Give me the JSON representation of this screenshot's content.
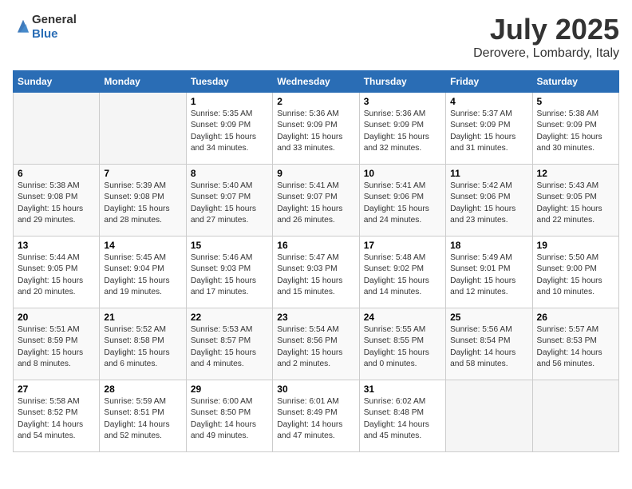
{
  "header": {
    "logo": {
      "general": "General",
      "blue": "Blue"
    },
    "month": "July 2025",
    "location": "Derovere, Lombardy, Italy"
  },
  "days_of_week": [
    "Sunday",
    "Monday",
    "Tuesday",
    "Wednesday",
    "Thursday",
    "Friday",
    "Saturday"
  ],
  "weeks": [
    [
      {
        "day": "",
        "empty": true
      },
      {
        "day": "",
        "empty": true
      },
      {
        "day": "1",
        "sunrise": "5:35 AM",
        "sunset": "9:09 PM",
        "daylight": "15 hours and 34 minutes."
      },
      {
        "day": "2",
        "sunrise": "5:36 AM",
        "sunset": "9:09 PM",
        "daylight": "15 hours and 33 minutes."
      },
      {
        "day": "3",
        "sunrise": "5:36 AM",
        "sunset": "9:09 PM",
        "daylight": "15 hours and 32 minutes."
      },
      {
        "day": "4",
        "sunrise": "5:37 AM",
        "sunset": "9:09 PM",
        "daylight": "15 hours and 31 minutes."
      },
      {
        "day": "5",
        "sunrise": "5:38 AM",
        "sunset": "9:09 PM",
        "daylight": "15 hours and 30 minutes."
      }
    ],
    [
      {
        "day": "6",
        "sunrise": "5:38 AM",
        "sunset": "9:08 PM",
        "daylight": "15 hours and 29 minutes."
      },
      {
        "day": "7",
        "sunrise": "5:39 AM",
        "sunset": "9:08 PM",
        "daylight": "15 hours and 28 minutes."
      },
      {
        "day": "8",
        "sunrise": "5:40 AM",
        "sunset": "9:07 PM",
        "daylight": "15 hours and 27 minutes."
      },
      {
        "day": "9",
        "sunrise": "5:41 AM",
        "sunset": "9:07 PM",
        "daylight": "15 hours and 26 minutes."
      },
      {
        "day": "10",
        "sunrise": "5:41 AM",
        "sunset": "9:06 PM",
        "daylight": "15 hours and 24 minutes."
      },
      {
        "day": "11",
        "sunrise": "5:42 AM",
        "sunset": "9:06 PM",
        "daylight": "15 hours and 23 minutes."
      },
      {
        "day": "12",
        "sunrise": "5:43 AM",
        "sunset": "9:05 PM",
        "daylight": "15 hours and 22 minutes."
      }
    ],
    [
      {
        "day": "13",
        "sunrise": "5:44 AM",
        "sunset": "9:05 PM",
        "daylight": "15 hours and 20 minutes."
      },
      {
        "day": "14",
        "sunrise": "5:45 AM",
        "sunset": "9:04 PM",
        "daylight": "15 hours and 19 minutes."
      },
      {
        "day": "15",
        "sunrise": "5:46 AM",
        "sunset": "9:03 PM",
        "daylight": "15 hours and 17 minutes."
      },
      {
        "day": "16",
        "sunrise": "5:47 AM",
        "sunset": "9:03 PM",
        "daylight": "15 hours and 15 minutes."
      },
      {
        "day": "17",
        "sunrise": "5:48 AM",
        "sunset": "9:02 PM",
        "daylight": "15 hours and 14 minutes."
      },
      {
        "day": "18",
        "sunrise": "5:49 AM",
        "sunset": "9:01 PM",
        "daylight": "15 hours and 12 minutes."
      },
      {
        "day": "19",
        "sunrise": "5:50 AM",
        "sunset": "9:00 PM",
        "daylight": "15 hours and 10 minutes."
      }
    ],
    [
      {
        "day": "20",
        "sunrise": "5:51 AM",
        "sunset": "8:59 PM",
        "daylight": "15 hours and 8 minutes."
      },
      {
        "day": "21",
        "sunrise": "5:52 AM",
        "sunset": "8:58 PM",
        "daylight": "15 hours and 6 minutes."
      },
      {
        "day": "22",
        "sunrise": "5:53 AM",
        "sunset": "8:57 PM",
        "daylight": "15 hours and 4 minutes."
      },
      {
        "day": "23",
        "sunrise": "5:54 AM",
        "sunset": "8:56 PM",
        "daylight": "15 hours and 2 minutes."
      },
      {
        "day": "24",
        "sunrise": "5:55 AM",
        "sunset": "8:55 PM",
        "daylight": "15 hours and 0 minutes."
      },
      {
        "day": "25",
        "sunrise": "5:56 AM",
        "sunset": "8:54 PM",
        "daylight": "14 hours and 58 minutes."
      },
      {
        "day": "26",
        "sunrise": "5:57 AM",
        "sunset": "8:53 PM",
        "daylight": "14 hours and 56 minutes."
      }
    ],
    [
      {
        "day": "27",
        "sunrise": "5:58 AM",
        "sunset": "8:52 PM",
        "daylight": "14 hours and 54 minutes."
      },
      {
        "day": "28",
        "sunrise": "5:59 AM",
        "sunset": "8:51 PM",
        "daylight": "14 hours and 52 minutes."
      },
      {
        "day": "29",
        "sunrise": "6:00 AM",
        "sunset": "8:50 PM",
        "daylight": "14 hours and 49 minutes."
      },
      {
        "day": "30",
        "sunrise": "6:01 AM",
        "sunset": "8:49 PM",
        "daylight": "14 hours and 47 minutes."
      },
      {
        "day": "31",
        "sunrise": "6:02 AM",
        "sunset": "8:48 PM",
        "daylight": "14 hours and 45 minutes."
      },
      {
        "day": "",
        "empty": true
      },
      {
        "day": "",
        "empty": true
      }
    ]
  ],
  "labels": {
    "sunrise": "Sunrise:",
    "sunset": "Sunset:",
    "daylight": "Daylight:"
  }
}
